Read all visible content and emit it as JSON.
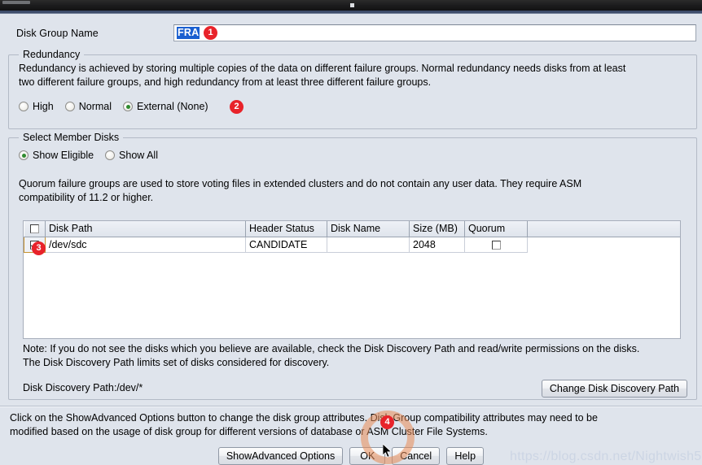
{
  "window": {
    "title": ""
  },
  "disk_group_name": {
    "label": "Disk Group Name",
    "value": "FRA",
    "placeholder": ""
  },
  "redundancy": {
    "legend": "Redundancy",
    "description_line1": "Redundancy is achieved by storing multiple copies of the data on different failure groups. Normal redundancy needs disks from at least",
    "description_line2": "two different failure groups, and high redundancy from at least three different failure groups.",
    "options": [
      {
        "label": "High",
        "selected": false
      },
      {
        "label": "Normal",
        "selected": false
      },
      {
        "label": "External (None)",
        "selected": true
      }
    ]
  },
  "member_disks": {
    "legend": "Select Member Disks",
    "filters": [
      {
        "label": "Show Eligible",
        "selected": true
      },
      {
        "label": "Show All",
        "selected": false
      }
    ],
    "quorum_note_line1": "Quorum failure groups are used to store voting files in extended clusters and do not contain any user data. They require ASM",
    "quorum_note_line2": "compatibility of 11.2 or higher.",
    "table": {
      "columns": [
        "",
        "Disk Path",
        "Header Status",
        "Disk Name",
        "Size (MB)",
        "Quorum",
        ""
      ],
      "header_select_all_checked": false,
      "rows": [
        {
          "selected": true,
          "disk_path": "/dev/sdc",
          "header_status": "CANDIDATE",
          "disk_name": "",
          "size_mb": "2048",
          "quorum": false
        }
      ]
    },
    "note_line1": "Note: If you do not see the disks which you believe are available, check the Disk Discovery Path and read/write permissions on the disks.",
    "note_line2": "The Disk Discovery Path limits set of disks considered for discovery.",
    "discovery_path_label": "Disk Discovery Path:/dev/*",
    "change_path_button": "Change Disk Discovery Path"
  },
  "footer": {
    "text_line1": "Click on the ShowAdvanced Options button to change the disk group attributes. Disk Group compatibility attributes may need to be",
    "text_line2": "modified based on the usage of disk group for different versions of database or ASM Cluster File Systems.",
    "buttons": [
      {
        "label": "ShowAdvanced Options"
      },
      {
        "label": "OK"
      },
      {
        "label": "Cancel"
      },
      {
        "label": "Help"
      }
    ]
  },
  "annotations": {
    "badges": [
      "1",
      "2",
      "3",
      "4"
    ]
  },
  "watermark": "https://blog.csdn.net/Nightwish5",
  "colors": {
    "panel_background": "#dfe4ec",
    "badge_red": "#e8232a",
    "radio_green": "#2f8b2f",
    "selection_blue": "#1a5fd0",
    "highlight_ring": "#e88a56",
    "watermark": "#ccd5e4"
  }
}
